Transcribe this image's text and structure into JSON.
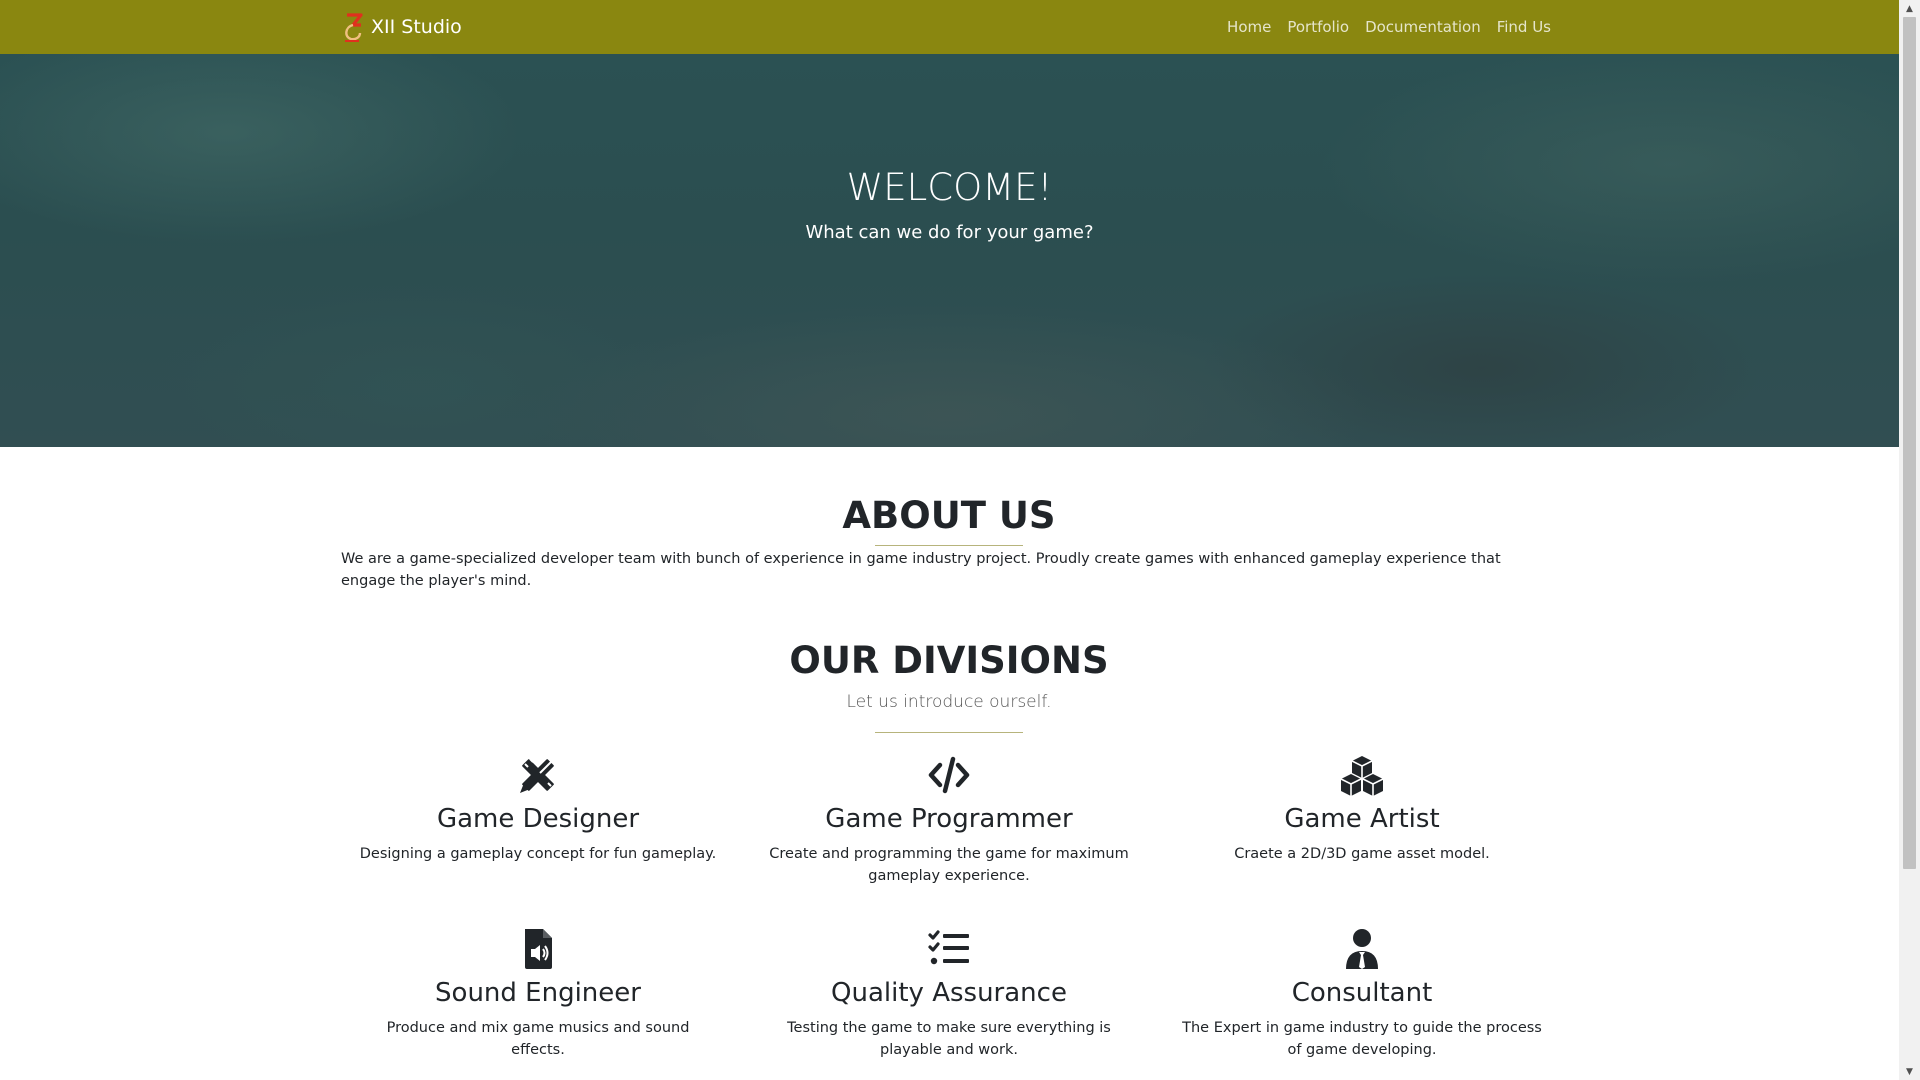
{
  "navbar": {
    "brand": "XII Studio",
    "logo_icon": "xii-studio-logo",
    "links": [
      "Home",
      "Portfolio",
      "Documentation",
      "Find Us"
    ],
    "background_color": "#8a8710"
  },
  "hero": {
    "title": "WELCOME!",
    "subtitle": "What can we do for your game?"
  },
  "about": {
    "title": "ABOUT US",
    "text": "We are a game-specialized developer team with bunch of experience in game industry project. Proudly create games with enhanced gameplay experience that engage the player's mind."
  },
  "divisions": {
    "title": "OUR DIVISIONS",
    "subtitle": "Let us introduce ourself.",
    "items": [
      {
        "icon": "pen-ruler-icon",
        "name": "Game Designer",
        "description": "Designing a gameplay concept for fun gameplay."
      },
      {
        "icon": "code-icon",
        "name": "Game Programmer",
        "description": "Create and programming the game for maximum gameplay experience."
      },
      {
        "icon": "cubes-icon",
        "name": "Game Artist",
        "description": "Craete a 2D/3D game asset model."
      },
      {
        "icon": "audio-file-icon",
        "name": "Sound Engineer",
        "description": "Produce and mix game musics and sound effects."
      },
      {
        "icon": "list-check-icon",
        "name": "Quality Assurance",
        "description": "Testing the game to make sure everything is playable and work."
      },
      {
        "icon": "user-tie-icon",
        "name": "Consultant",
        "description": "The Expert in game industry to guide the process of game developing."
      }
    ]
  }
}
